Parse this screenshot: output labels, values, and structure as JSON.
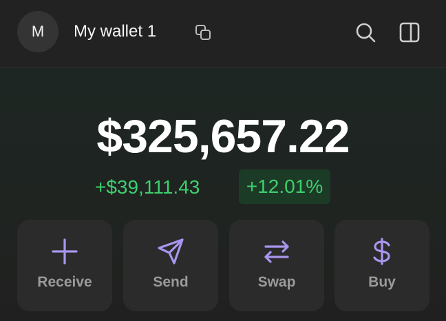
{
  "header": {
    "avatar_letter": "M",
    "wallet_name": "My wallet 1",
    "icons": [
      "copy-icon",
      "search-icon",
      "sidebar-panel-icon"
    ]
  },
  "portfolio": {
    "balance": "$325,657.22",
    "change_amount": "+$39,111.43",
    "change_percent": "+12.01%"
  },
  "actions": [
    {
      "label": "Receive",
      "icon": "plus-icon"
    },
    {
      "label": "Send",
      "icon": "send-icon"
    },
    {
      "label": "Swap",
      "icon": "swap-icon"
    },
    {
      "label": "Buy",
      "icon": "dollar-icon"
    }
  ],
  "colors": {
    "background": "#1f1f1f",
    "accent_purple": "#a996ef",
    "positive_green": "#3ecf6e",
    "positive_bg": "#1c3b27",
    "button_bg": "#2b2b2b"
  }
}
